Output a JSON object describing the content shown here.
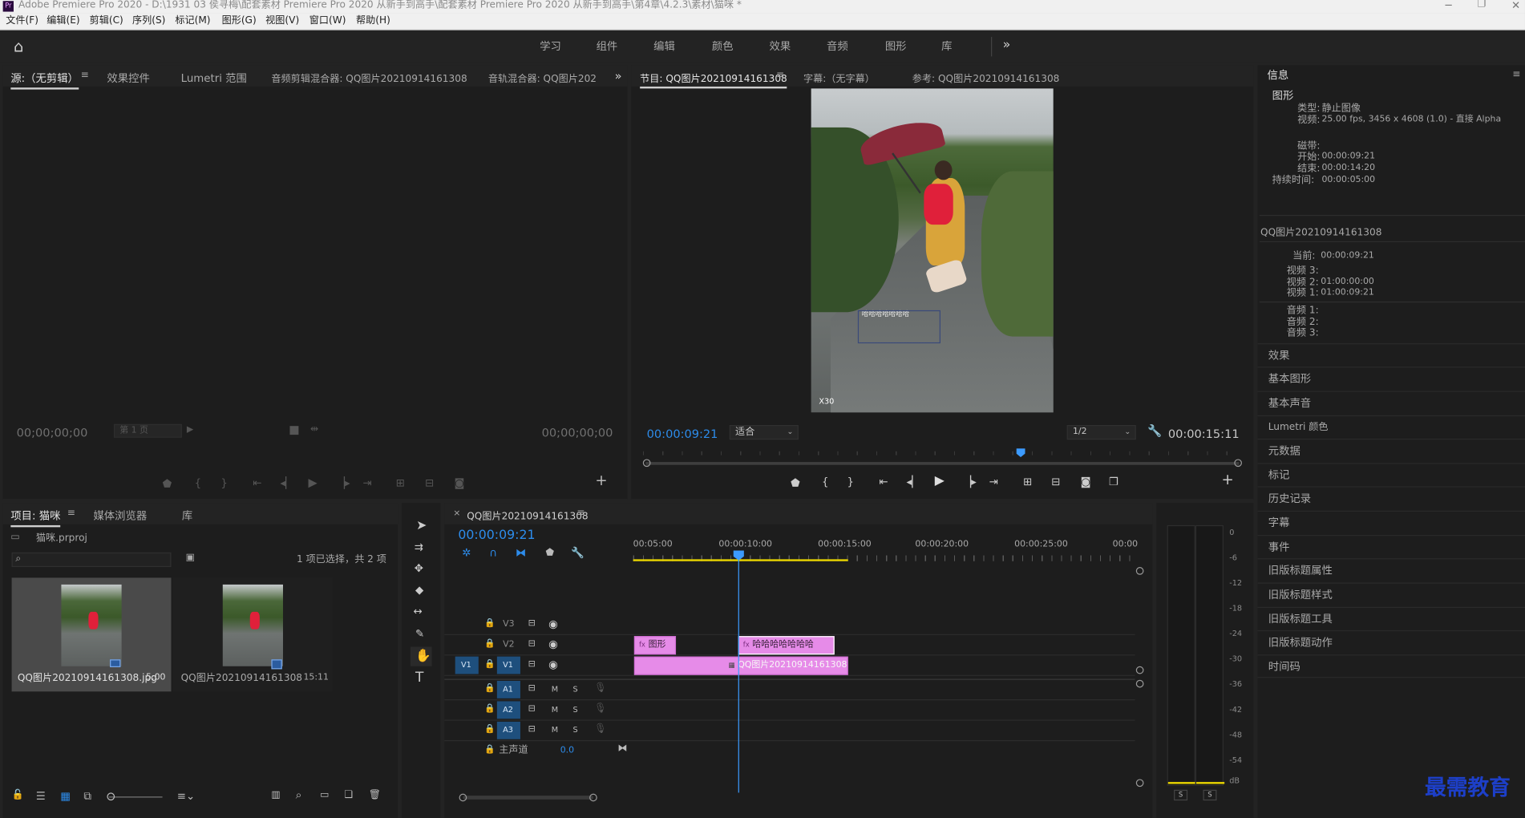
{
  "window": {
    "title": "Adobe Premiere Pro 2020 - D:\\1931 03 侯寻梅\\配套素材 Premiere Pro 2020 从新手到高手\\配套素材 Premiere Pro 2020 从新手到高手\\第4章\\4.2.3\\素材\\猫咪 *",
    "app_icon": "Pr"
  },
  "menu": [
    "文件(F)",
    "编辑(E)",
    "剪辑(C)",
    "序列(S)",
    "标记(M)",
    "图形(G)",
    "视图(V)",
    "窗口(W)",
    "帮助(H)"
  ],
  "workspaces": [
    "学习",
    "组件",
    "编辑",
    "颜色",
    "效果",
    "音频",
    "图形",
    "库"
  ],
  "source_panel": {
    "tabs": [
      "源:（无剪辑）",
      "效果控件",
      "Lumetri 范围",
      "音频剪辑混合器: QQ图片20210914161308",
      "音轨混合器: QQ图片202"
    ],
    "tc_left": "00;00;00;00",
    "tc_right": "00;00;00;00",
    "page": "第 1 页"
  },
  "program_panel": {
    "tabs": [
      "节目: QQ图片20210914161308",
      "字幕:（无字幕）",
      "参考: QQ图片20210914161308"
    ],
    "tc_current": "00:00:09:21",
    "fit": "适合",
    "resolution": "1/2",
    "tc_duration": "00:00:15:11",
    "overlay_text": "哈哈哈哈哈哈哈",
    "watermark": "X30"
  },
  "info_panel": {
    "title": "信息",
    "section1": "图形",
    "type_label": "类型:",
    "type_value": "静止图像",
    "video_label": "视频:",
    "video_value": "25.00 fps, 3456 x 4608 (1.0) - 直接 Alpha",
    "tape_label": "磁带:",
    "start_label": "开始:",
    "start_value": "00:00:09:21",
    "end_label": "结束:",
    "end_value": "00:00:14:20",
    "dur_label": "持续时间:",
    "dur_value": "00:00:05:00",
    "seq_name": "QQ图片20210914161308",
    "cur_label": "当前:",
    "cur_value": "00:00:09:21",
    "v3": "视频 3:",
    "v2": "视频 2:",
    "v2_value": "01:00:00:00",
    "v1": "视频 1:",
    "v1_value": "01:00:09:21",
    "a1": "音频 1:",
    "a2": "音频 2:",
    "a3": "音频 3:"
  },
  "side_items": [
    "效果",
    "基本图形",
    "基本声音",
    "Lumetri 颜色",
    "元数据",
    "标记",
    "历史记录",
    "字幕",
    "事件",
    "旧版标题属性",
    "旧版标题样式",
    "旧版标题工具",
    "旧版标题动作",
    "时间码"
  ],
  "project_panel": {
    "tabs": [
      "项目: 猫咪",
      "媒体浏览器",
      "库"
    ],
    "file": "猫咪.prproj",
    "selection": "1 项已选择，共 2 项",
    "items": [
      {
        "name": "QQ图片20210914161308.jpg",
        "dur": "5:00"
      },
      {
        "name": "QQ图片20210914161308",
        "dur": "15:11"
      }
    ]
  },
  "timeline": {
    "tab": "QQ图片20210914161308",
    "tc": "00:00:09:21",
    "ruler": [
      "00:05:00",
      "00:00:10:00",
      "00:00:15:00",
      "00:00:20:00",
      "00:00:25:00",
      "00:00"
    ],
    "tracks": {
      "v3": "V3",
      "v2": "V2",
      "v1": "V1",
      "a1": "A1",
      "a2": "A2",
      "a3": "A3",
      "master": "主声道",
      "master_val": "0.0",
      "src_v1": "V1",
      "m": "M",
      "s": "S"
    },
    "clips": {
      "graphic": "图形",
      "text": "哈哈哈哈哈哈哈",
      "image": "QQ图片20210914161308.jpg",
      "fx": "fx"
    }
  },
  "meters": {
    "labels": [
      "0",
      "-6",
      "-12",
      "-18",
      "-24",
      "-30",
      "-36",
      "-42",
      "-48",
      "-54",
      "dB"
    ],
    "solo": "S"
  },
  "brand": "最需教育",
  "colors": {
    "accent": "#2d8ceb",
    "clip": "#e68be8",
    "playhead": "#3c9bff",
    "work_area": "#e8d400"
  }
}
